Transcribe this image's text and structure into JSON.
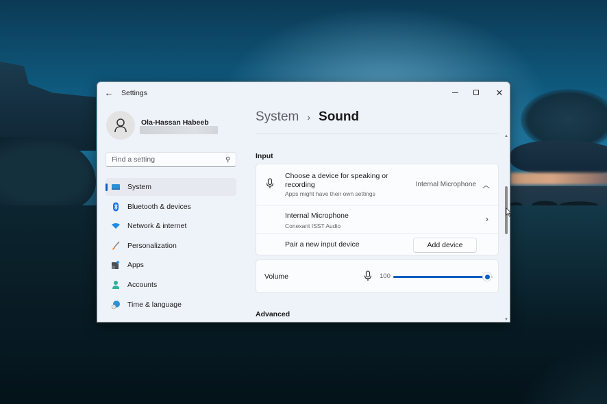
{
  "window": {
    "app_title": "Settings",
    "controls": {
      "minimize": "Minimize",
      "maximize": "Maximize",
      "close": "Close"
    }
  },
  "profile": {
    "name": "Ola-Hassan Habeeb",
    "email_redacted": true
  },
  "search": {
    "placeholder": "Find a setting",
    "value": ""
  },
  "sidebar": {
    "active_index": 0,
    "items": [
      {
        "label": "System",
        "icon": "monitor-icon"
      },
      {
        "label": "Bluetooth & devices",
        "icon": "bluetooth-icon"
      },
      {
        "label": "Network & internet",
        "icon": "wifi-icon"
      },
      {
        "label": "Personalization",
        "icon": "brush-icon"
      },
      {
        "label": "Apps",
        "icon": "apps-icon"
      },
      {
        "label": "Accounts",
        "icon": "person-icon"
      },
      {
        "label": "Time & language",
        "icon": "globe-clock-icon"
      }
    ]
  },
  "main": {
    "breadcrumb": {
      "parent": "System",
      "separator": "›",
      "current": "Sound"
    },
    "input_section": {
      "label": "Input",
      "choose_device": {
        "title": "Choose a device for speaking or recording",
        "subtitle": "Apps might have their own settings",
        "value": "Internal Microphone",
        "expanded": true
      },
      "device": {
        "name": "Internal Microphone",
        "driver": "Conexant ISST Audio"
      },
      "pair": {
        "label": "Pair a new input device",
        "button": "Add device"
      },
      "volume": {
        "label": "Volume",
        "value": 100,
        "max": 100
      }
    },
    "advanced_section": {
      "label": "Advanced"
    }
  },
  "colors": {
    "accent": "#0a5ec0",
    "window_bg": "#eef2f9",
    "card_bg": "#fbfcfe"
  }
}
